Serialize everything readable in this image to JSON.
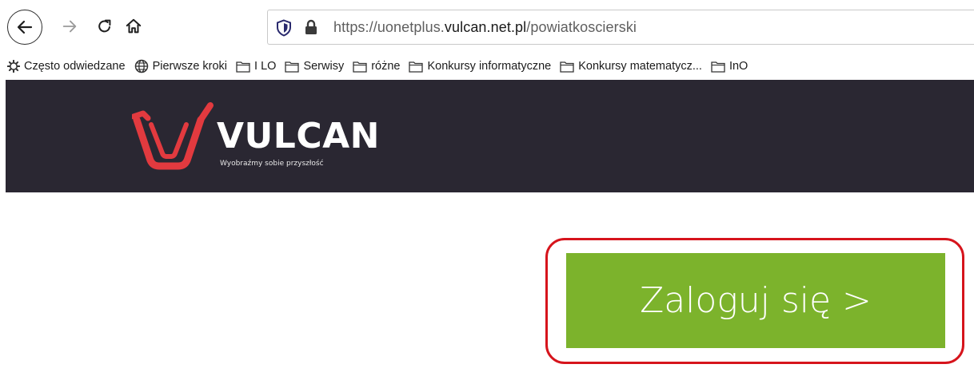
{
  "browser": {
    "url": {
      "scheme": "https://uonetplus.",
      "domain": "vulcan.net.pl",
      "path": "/powiatkoscierski"
    },
    "bookmarks": [
      {
        "label": "Często odwiedzane",
        "icon": "gear-icon"
      },
      {
        "label": "Pierwsze kroki",
        "icon": "globe-icon"
      },
      {
        "label": "I LO",
        "icon": "folder-icon"
      },
      {
        "label": "Serwisy",
        "icon": "folder-icon"
      },
      {
        "label": "różne",
        "icon": "folder-icon"
      },
      {
        "label": "Konkursy informatyczne",
        "icon": "folder-icon"
      },
      {
        "label": "Konkursy matematycz...",
        "icon": "folder-icon"
      },
      {
        "label": "InO",
        "icon": "folder-icon"
      }
    ]
  },
  "header": {
    "logo_text": "VULCAN",
    "tagline": "Wyobraźmy sobie przyszłość",
    "background": "#2a2732"
  },
  "main": {
    "login_label": "Zaloguj się >",
    "button_color": "#7cb32c",
    "highlight_color": "#d6141c"
  }
}
